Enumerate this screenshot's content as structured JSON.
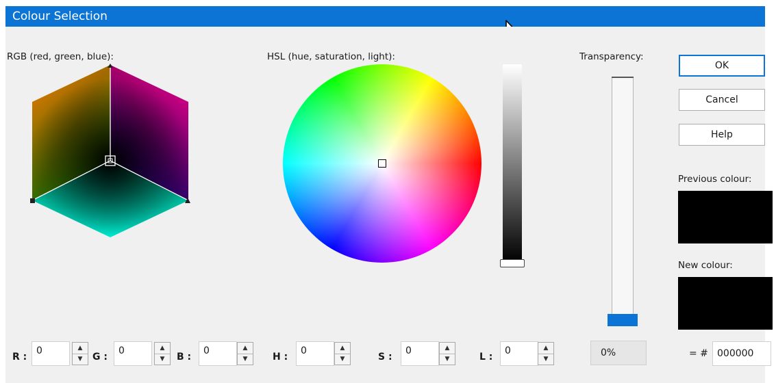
{
  "window": {
    "title": "Colour Selection"
  },
  "rgb": {
    "label": "RGB (red, green, blue):"
  },
  "hsl": {
    "label": "HSL (hue, saturation, light):"
  },
  "transparency": {
    "label": "Transparency:",
    "value": "0%"
  },
  "buttons": {
    "ok": "OK",
    "cancel": "Cancel",
    "help": "Help"
  },
  "previous_colour": {
    "label": "Previous colour:",
    "color": "#000000"
  },
  "new_colour": {
    "label": "New colour:",
    "color": "#000000"
  },
  "fields": {
    "r": {
      "label": "R :",
      "value": "0"
    },
    "g": {
      "label": "G :",
      "value": "0"
    },
    "b": {
      "label": "B :",
      "value": "0"
    },
    "h": {
      "label": "H :",
      "value": "0"
    },
    "s": {
      "label": "S :",
      "value": "0"
    },
    "l": {
      "label": "L :",
      "value": "0"
    }
  },
  "hex": {
    "prefix": "= #",
    "value": "000000"
  },
  "colors": {
    "titlebar": "#0b74d4",
    "accent": "#0b74d4",
    "dialog_bg": "#f0f0f0"
  }
}
